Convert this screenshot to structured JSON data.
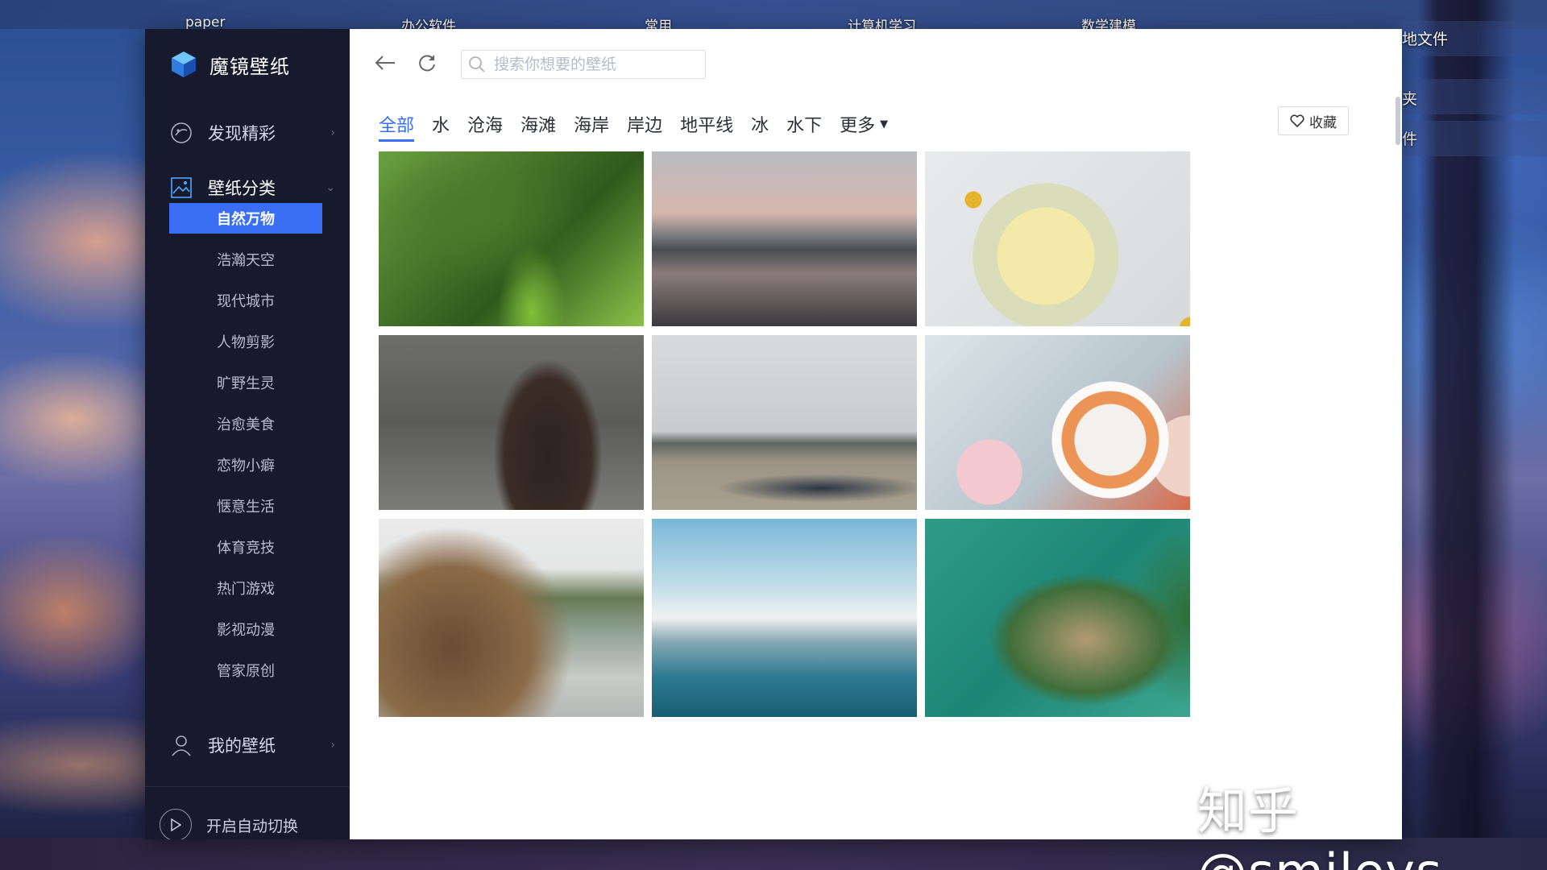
{
  "desktop": {
    "top_labels": [
      "paper",
      "办公软件",
      "常用",
      "计算机学习",
      "数学建模"
    ],
    "right_labels": [
      "地文件",
      "夹",
      "件"
    ]
  },
  "app": {
    "brand_name": "魔镜壁纸",
    "accent_color": "#3a6ef5",
    "sidebar": {
      "nav": [
        {
          "label": "发现精彩",
          "icon": "discover-icon",
          "arrow": "›"
        },
        {
          "label": "壁纸分类",
          "icon": "category-icon",
          "arrow": "⌄"
        },
        {
          "label": "我的壁纸",
          "icon": "user-icon",
          "arrow": "›"
        }
      ],
      "categories": [
        "自然万物",
        "浩瀚天空",
        "现代城市",
        "人物剪影",
        "旷野生灵",
        "治愈美食",
        "恋物小癖",
        "惬意生活",
        "体育竞技",
        "热门游戏",
        "影视动漫",
        "管家原创"
      ],
      "active_category": "自然万物",
      "auto_switch_label": "开启自动切换"
    },
    "toolbar": {
      "search_placeholder": "搜索你想要的壁纸",
      "fav_label": "收藏"
    },
    "tabs": [
      "全部",
      "水",
      "沧海",
      "海滩",
      "海岸",
      "岸边",
      "地平线",
      "冰",
      "水下",
      "更多"
    ],
    "active_tab": "全部",
    "wallpapers": [
      {
        "name": "dragonfly-on-leaf"
      },
      {
        "name": "sunset-mountain-lake"
      },
      {
        "name": "lemon-mint-drink"
      },
      {
        "name": "woman-dress-water"
      },
      {
        "name": "river-cargo-ship"
      },
      {
        "name": "tea-tulips-macarons"
      },
      {
        "name": "sea-cliff-coast"
      },
      {
        "name": "marina-sailboats"
      },
      {
        "name": "aerial-green-peninsula"
      }
    ]
  },
  "watermark": "知乎 @smileys"
}
